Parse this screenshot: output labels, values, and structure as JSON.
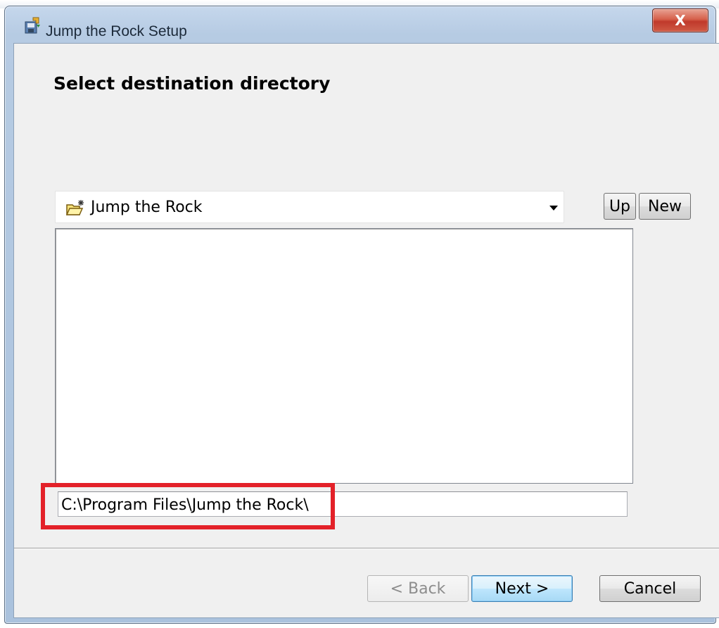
{
  "window": {
    "title": "Jump the Rock Setup",
    "close_label": "X"
  },
  "page": {
    "heading": "Select destination directory"
  },
  "folder_combo": {
    "selected": "Jump the Rock"
  },
  "buttons": {
    "up": "Up",
    "new": "New",
    "back": "< Back",
    "next": "Next >",
    "cancel": "Cancel"
  },
  "path_field": {
    "value": "C:\\Program Files\\Jump the Rock\\"
  },
  "highlight_color": "#e32129"
}
